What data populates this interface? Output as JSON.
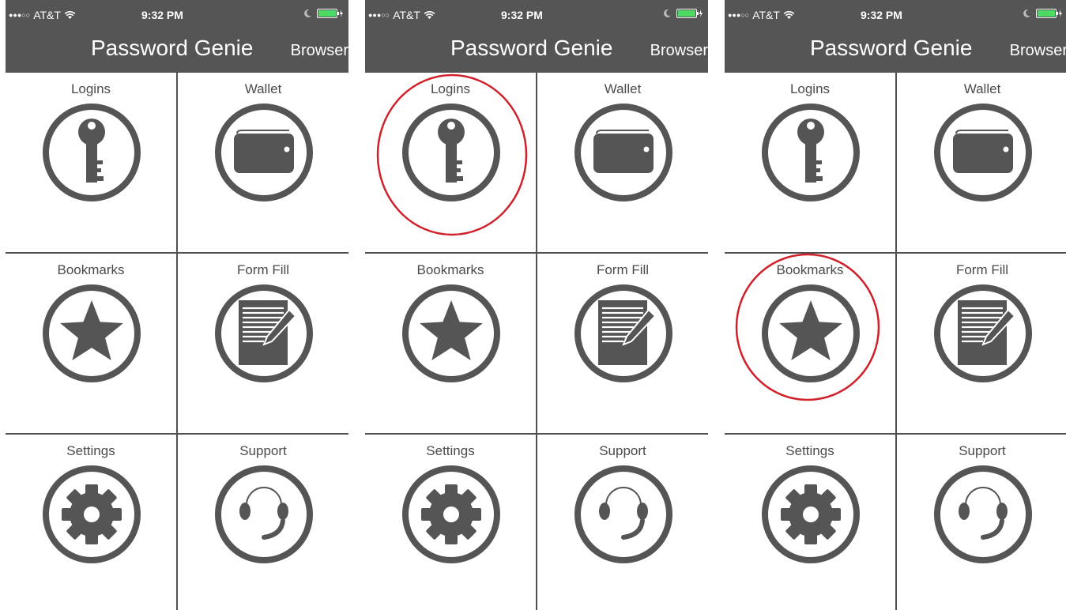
{
  "status_bar": {
    "carrier": "AT&T",
    "time": "9:32 PM"
  },
  "header": {
    "title": "Password Genie",
    "browser_label": "Browser"
  },
  "menu": [
    {
      "label": "Logins",
      "icon": "key-icon"
    },
    {
      "label": "Wallet",
      "icon": "wallet-icon"
    },
    {
      "label": "Bookmarks",
      "icon": "star-icon"
    },
    {
      "label": "Form Fill",
      "icon": "form-fill-icon"
    },
    {
      "label": "Settings",
      "icon": "gear-icon"
    },
    {
      "label": "Support",
      "icon": "headset-icon"
    }
  ],
  "annotations": [
    {
      "screen": 1,
      "highlighted_item": null
    },
    {
      "screen": 2,
      "highlighted_item": "Logins"
    },
    {
      "screen": 3,
      "highlighted_item": "Bookmarks"
    }
  ],
  "colors": {
    "header_bg": "#555556",
    "icon": "#555555",
    "highlight_circle": "#d0202a",
    "battery": "#4cd964"
  }
}
